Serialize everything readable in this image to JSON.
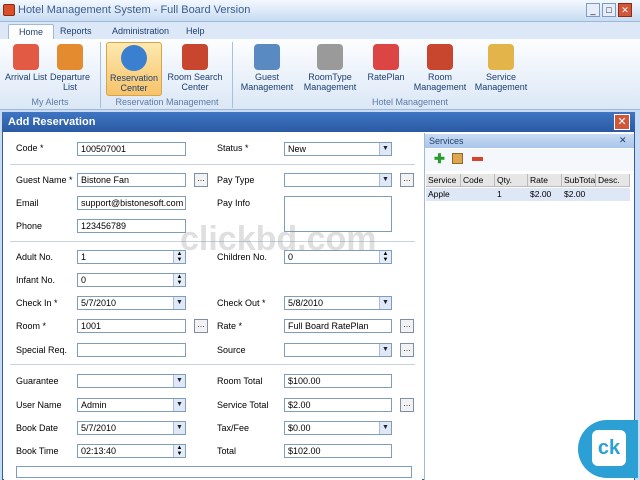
{
  "window": {
    "title": "Hotel Management System - Full Board Version"
  },
  "tabs": [
    "Home",
    "Reports",
    "Administration",
    "Help"
  ],
  "ribbon": {
    "buttons": [
      {
        "label": "Arrival List",
        "icon": "arrival-icon"
      },
      {
        "label": "Departure List",
        "icon": "departure-icon"
      },
      {
        "label": "Reservation Center",
        "icon": "globe-icon"
      },
      {
        "label": "Room Search Center",
        "icon": "house-search-icon"
      },
      {
        "label": "Guest Management",
        "icon": "guests-icon"
      },
      {
        "label": "RoomType Management",
        "icon": "building-icon"
      },
      {
        "label": "RatePlan",
        "icon": "calendar-icon"
      },
      {
        "label": "Room Management",
        "icon": "house-icon"
      },
      {
        "label": "Service Management",
        "icon": "box-icon"
      }
    ],
    "groups": [
      "My Alerts",
      "Reservation Management",
      "Hotel Management"
    ]
  },
  "dialog": {
    "title": "Add Reservation"
  },
  "form": {
    "code_label": "Code *",
    "code": "100507001",
    "status_label": "Status *",
    "status": "New",
    "guest_label": "Guest Name *",
    "guest": "Bistone Fan",
    "paytype_label": "Pay Type",
    "paytype": "",
    "email_label": "Email",
    "email": "support@bistonesoft.com",
    "payinfo_label": "Pay Info",
    "phone_label": "Phone",
    "phone": "123456789",
    "adult_label": "Adult No.",
    "adult": "1",
    "children_label": "Children No.",
    "children": "0",
    "infant_label": "Infant No.",
    "infant": "0",
    "checkin_label": "Check In *",
    "checkin": "5/7/2010",
    "checkout_label": "Check Out *",
    "checkout": "5/8/2010",
    "room_label": "Room *",
    "room": "1001",
    "rate_label": "Rate *",
    "rate": "Full Board RatePlan",
    "special_label": "Special Req.",
    "special": "",
    "source_label": "Source",
    "source": "",
    "guarantee_label": "Guarantee",
    "guarantee": "",
    "roomtotal_label": "Room Total",
    "roomtotal": "$100.00",
    "username_label": "User Name",
    "username": "Admin",
    "servicetotal_label": "Service Total",
    "servicetotal": "$2.00",
    "bookdate_label": "Book Date",
    "bookdate": "5/7/2010",
    "taxfee_label": "Tax/Fee",
    "taxfee": "$0.00",
    "booktime_label": "Book Time",
    "booktime": "02:13:40",
    "total_label": "Total",
    "total": "$102.00"
  },
  "services": {
    "title": "Services",
    "columns": [
      "Service",
      "Code",
      "Qty.",
      "Rate",
      "SubTota",
      "Desc."
    ],
    "rows": [
      [
        "Apple",
        "",
        "1",
        "$2.00",
        "$2.00",
        ""
      ]
    ]
  },
  "watermark": "clickbd.com"
}
